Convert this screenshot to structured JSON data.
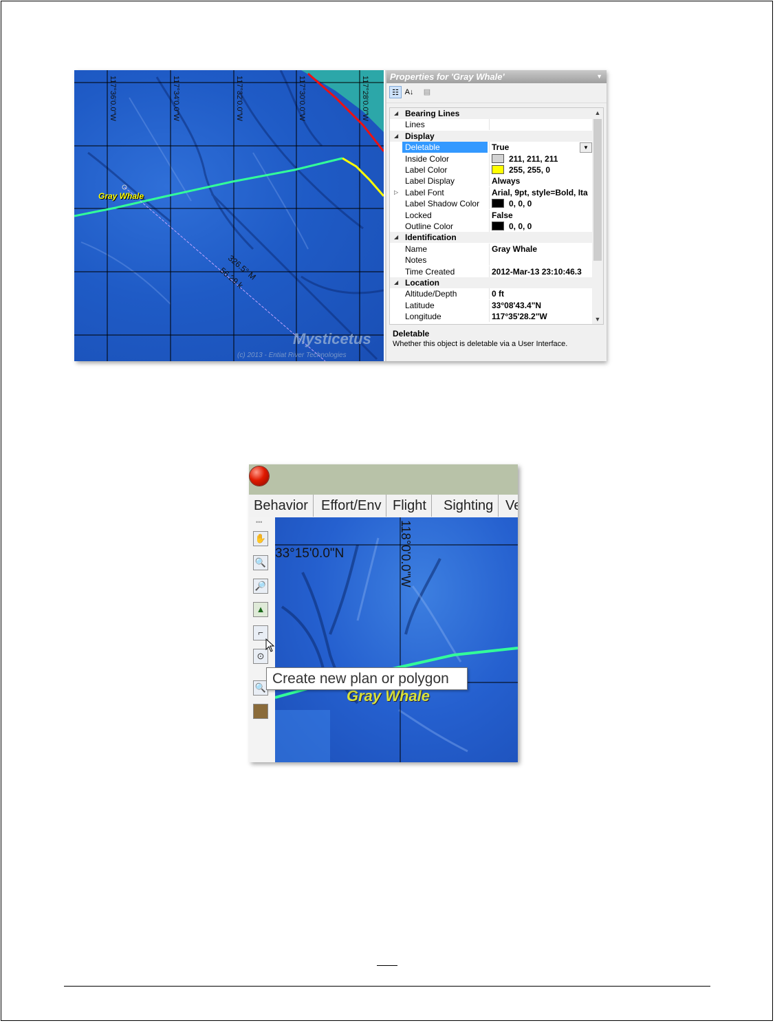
{
  "screenshot1": {
    "map": {
      "longitude_labels": [
        "117°36'0.0\"W",
        "117°34'0.0\"W",
        "117°32'0.0\"W",
        "117°30'0.0\"W",
        "117°28'0.0\"W"
      ],
      "target_label": "Gray Whale",
      "bearing_label_1": "326.5° M",
      "bearing_label_2": "56.29 k",
      "brand": "Mysticetus",
      "copyright": "(c) 2013 - Entiat River Technologies",
      "colors": {
        "track_green": "#33ff99",
        "track_yellow": "#ffff00",
        "track_red": "#ee1111",
        "label_yellow": "#ffff00",
        "ocean": "#1f5bc6"
      }
    },
    "properties": {
      "title": "Properties for 'Gray Whale'",
      "toolbar": {
        "categorized_icon": "categorized-view-icon",
        "alphabetical_icon": "sort-az-icon",
        "pages_icon": "property-pages-icon"
      },
      "rows": [
        {
          "type": "category",
          "name": "Bearing Lines"
        },
        {
          "type": "prop",
          "name": "Lines",
          "value": ""
        },
        {
          "type": "category",
          "name": "Display"
        },
        {
          "type": "prop",
          "name": "Deletable",
          "value": "True",
          "selected": true
        },
        {
          "type": "prop",
          "name": "Inside Color",
          "value": "211, 211, 211",
          "swatch": "#d3d3d3"
        },
        {
          "type": "prop",
          "name": "Label Color",
          "value": "255, 255, 0",
          "swatch": "#ffff00"
        },
        {
          "type": "prop",
          "name": "Label Display",
          "value": "Always"
        },
        {
          "type": "prop",
          "name": "Label Font",
          "value": "Arial, 9pt, style=Bold, Ita",
          "expandable": true
        },
        {
          "type": "prop",
          "name": "Label Shadow Color",
          "value": "0, 0, 0",
          "swatch": "#000000"
        },
        {
          "type": "prop",
          "name": "Locked",
          "value": "False"
        },
        {
          "type": "prop",
          "name": "Outline Color",
          "value": "0, 0, 0",
          "swatch": "#000000"
        },
        {
          "type": "category",
          "name": "Identification"
        },
        {
          "type": "prop",
          "name": "Name",
          "value": "Gray Whale"
        },
        {
          "type": "prop",
          "name": "Notes",
          "value": ""
        },
        {
          "type": "prop",
          "name": "Time Created",
          "value": "2012-Mar-13 23:10:46.3"
        },
        {
          "type": "category",
          "name": "Location"
        },
        {
          "type": "prop",
          "name": "Altitude/Depth",
          "value": "0 ft"
        },
        {
          "type": "prop",
          "name": "Latitude",
          "value": "33°08'43.4\"N"
        },
        {
          "type": "prop",
          "name": "Longitude",
          "value": "117°35'28.2\"W"
        }
      ],
      "help_title": "Deletable",
      "help_text": "Whether this object is deletable via a User Interface."
    }
  },
  "screenshot2": {
    "tabs": [
      "Behavior",
      "Effort/Env",
      "Flight",
      "Sighting",
      "Ve"
    ],
    "tools": [
      "pan-hand-icon",
      "zoom-in-icon",
      "zoom-out-icon",
      "tree-icon",
      "polygon-icon",
      "target-icon",
      "zoom-icon",
      "image-icon"
    ],
    "latitude_label": "33°15'0.0\"N",
    "longitude_label": "118°0'0.0\"W",
    "target_label": "Gray Whale",
    "tooltip": "Create new plan or polygon"
  },
  "page_number": ""
}
